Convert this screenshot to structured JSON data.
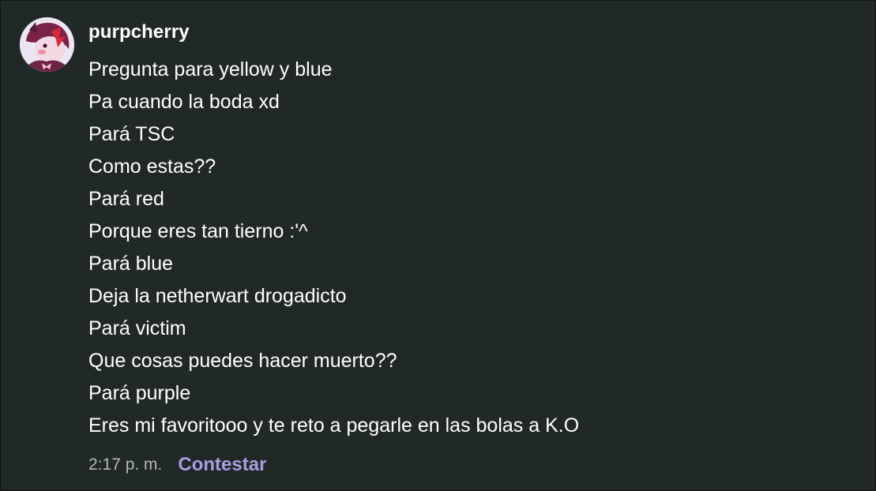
{
  "comment": {
    "avatar_icon": "user-avatar",
    "username": "purpcherry",
    "lines": [
      "Pregunta para yellow y blue",
      "Pa cuando la boda xd",
      "Pará TSC",
      "Como estas??",
      "Pará red",
      "Porque eres tan tierno :'^",
      "Pará blue",
      "Deja la netherwart drogadicto",
      "Pará victim",
      "Que cosas puedes hacer muerto??",
      "Pará purple",
      "Eres mi favoritooo y te reto a pegarle en las bolas a K.O"
    ],
    "timestamp": "2:17 p. m.",
    "reply_label": "Contestar"
  },
  "colors": {
    "background": "#212828",
    "text": "#ffffff",
    "timestamp": "#b4b8b8",
    "accent": "#a79fe0"
  }
}
